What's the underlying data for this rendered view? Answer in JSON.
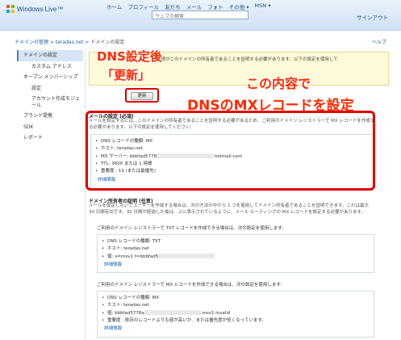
{
  "header": {
    "logo_text": "Windows Live™",
    "nav": [
      "ホーム",
      "プロフィール",
      "友だち",
      "メール",
      "フォト",
      "その他 ▾",
      "MSN ▾"
    ],
    "search_placeholder": "ウェブの検索",
    "signin": "サインアウト"
  },
  "breadcrumb": {
    "items": [
      "ドメインの管理",
      "teradas.net",
      "ドメインの設定"
    ],
    "separator": ">",
    "help": "ヘルプ"
  },
  "sidebar": {
    "items": [
      {
        "label": "ドメインの設定",
        "selected": true
      },
      {
        "label": "カスタム アドレス"
      },
      {
        "label": "オープン メンバーシップ"
      },
      {
        "label": "設定"
      },
      {
        "label": "アカウント作成モジュール"
      },
      {
        "label": "ブランド提携"
      },
      {
        "label": "SDK"
      },
      {
        "label": "レポート"
      }
    ]
  },
  "warning": {
    "text": "…お客様がこのドメインの所有者であることを証明する必要があります。以下の設定を使用して"
  },
  "update_button": "更新",
  "mail_settings": {
    "title": "メールの設定 (必須)",
    "description": "メールを設定するには、このドメインの所有者であることを証明する必要があるため、ご利用のドメイン レジストラーで MX レコードを作成する必要があります。以下の設定を使用してください:",
    "record_type": "DNS レコードの種類: MX",
    "host": "ホスト: teradas.net",
    "mx_server_prefix": "MX サーバー: bbbfad5778",
    "mx_server_suffix": ".hotmail.com",
    "ttl": "TTL: 3600 または 1 時間",
    "priority": "重要度 : 10 (または最優先)",
    "details": "詳細情報"
  },
  "ownership": {
    "title": "ドメイン所有者の証明 (任意)",
    "description": "メールを設定しないでユーザーを作成する場合は、次の方法の中から 1 つを使用してドメイン所有者であることを証明できます。これは最大 30 日間有効です。30 日間が経過した後は、上に表示されているように、メール ルーティングの MX レコードを設定する必要があります。",
    "txt_intro": "ご利用のドメイン レジストラーで TXT レコードを作成できる場合は、次の設定を使用します:",
    "txt_type": "DNS レコードの種類: TXT",
    "txt_host": "ホスト: teradas.net",
    "txt_value": "値: v=msv1 t=bbbfad5",
    "txt_details": "詳細情報",
    "mx_intro": "ご利用のドメイン レジストラーで MX レコードを作成できる場合は、次の設定を使用します:",
    "mx_type": "DNS レコードの種類: MX",
    "mx_host": "ホスト: teradas.net",
    "mx_value_prefix": "値: bbbfad5778a",
    "mx_value_suffix": ".msv1.invalid",
    "mx_priority": "重要度 : 既存のレコードよりも値が高いか、または優先度が低くなっています。",
    "mx_details": "詳細情報"
  },
  "annotations": {
    "dns_after_line1": "DNS設定後",
    "dns_after_line2": "「更新」",
    "this_content": "この内容で",
    "set_mx": "DNSのMXレコードを設定"
  },
  "colors": {
    "accent": "#1b5fa8",
    "callout": "#ff2a00",
    "highlight_border": "#e00000"
  }
}
